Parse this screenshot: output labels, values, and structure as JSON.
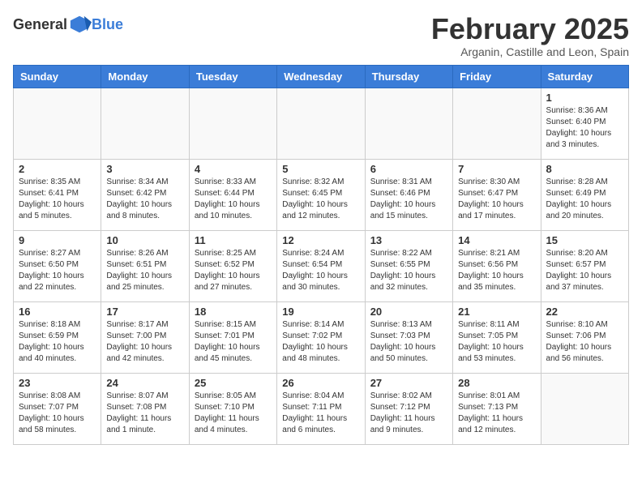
{
  "header": {
    "logo_general": "General",
    "logo_blue": "Blue",
    "title": "February 2025",
    "subtitle": "Arganin, Castille and Leon, Spain"
  },
  "weekdays": [
    "Sunday",
    "Monday",
    "Tuesday",
    "Wednesday",
    "Thursday",
    "Friday",
    "Saturday"
  ],
  "weeks": [
    [
      {
        "day": "",
        "info": ""
      },
      {
        "day": "",
        "info": ""
      },
      {
        "day": "",
        "info": ""
      },
      {
        "day": "",
        "info": ""
      },
      {
        "day": "",
        "info": ""
      },
      {
        "day": "",
        "info": ""
      },
      {
        "day": "1",
        "info": "Sunrise: 8:36 AM\nSunset: 6:40 PM\nDaylight: 10 hours\nand 3 minutes."
      }
    ],
    [
      {
        "day": "2",
        "info": "Sunrise: 8:35 AM\nSunset: 6:41 PM\nDaylight: 10 hours\nand 5 minutes."
      },
      {
        "day": "3",
        "info": "Sunrise: 8:34 AM\nSunset: 6:42 PM\nDaylight: 10 hours\nand 8 minutes."
      },
      {
        "day": "4",
        "info": "Sunrise: 8:33 AM\nSunset: 6:44 PM\nDaylight: 10 hours\nand 10 minutes."
      },
      {
        "day": "5",
        "info": "Sunrise: 8:32 AM\nSunset: 6:45 PM\nDaylight: 10 hours\nand 12 minutes."
      },
      {
        "day": "6",
        "info": "Sunrise: 8:31 AM\nSunset: 6:46 PM\nDaylight: 10 hours\nand 15 minutes."
      },
      {
        "day": "7",
        "info": "Sunrise: 8:30 AM\nSunset: 6:47 PM\nDaylight: 10 hours\nand 17 minutes."
      },
      {
        "day": "8",
        "info": "Sunrise: 8:28 AM\nSunset: 6:49 PM\nDaylight: 10 hours\nand 20 minutes."
      }
    ],
    [
      {
        "day": "9",
        "info": "Sunrise: 8:27 AM\nSunset: 6:50 PM\nDaylight: 10 hours\nand 22 minutes."
      },
      {
        "day": "10",
        "info": "Sunrise: 8:26 AM\nSunset: 6:51 PM\nDaylight: 10 hours\nand 25 minutes."
      },
      {
        "day": "11",
        "info": "Sunrise: 8:25 AM\nSunset: 6:52 PM\nDaylight: 10 hours\nand 27 minutes."
      },
      {
        "day": "12",
        "info": "Sunrise: 8:24 AM\nSunset: 6:54 PM\nDaylight: 10 hours\nand 30 minutes."
      },
      {
        "day": "13",
        "info": "Sunrise: 8:22 AM\nSunset: 6:55 PM\nDaylight: 10 hours\nand 32 minutes."
      },
      {
        "day": "14",
        "info": "Sunrise: 8:21 AM\nSunset: 6:56 PM\nDaylight: 10 hours\nand 35 minutes."
      },
      {
        "day": "15",
        "info": "Sunrise: 8:20 AM\nSunset: 6:57 PM\nDaylight: 10 hours\nand 37 minutes."
      }
    ],
    [
      {
        "day": "16",
        "info": "Sunrise: 8:18 AM\nSunset: 6:59 PM\nDaylight: 10 hours\nand 40 minutes."
      },
      {
        "day": "17",
        "info": "Sunrise: 8:17 AM\nSunset: 7:00 PM\nDaylight: 10 hours\nand 42 minutes."
      },
      {
        "day": "18",
        "info": "Sunrise: 8:15 AM\nSunset: 7:01 PM\nDaylight: 10 hours\nand 45 minutes."
      },
      {
        "day": "19",
        "info": "Sunrise: 8:14 AM\nSunset: 7:02 PM\nDaylight: 10 hours\nand 48 minutes."
      },
      {
        "day": "20",
        "info": "Sunrise: 8:13 AM\nSunset: 7:03 PM\nDaylight: 10 hours\nand 50 minutes."
      },
      {
        "day": "21",
        "info": "Sunrise: 8:11 AM\nSunset: 7:05 PM\nDaylight: 10 hours\nand 53 minutes."
      },
      {
        "day": "22",
        "info": "Sunrise: 8:10 AM\nSunset: 7:06 PM\nDaylight: 10 hours\nand 56 minutes."
      }
    ],
    [
      {
        "day": "23",
        "info": "Sunrise: 8:08 AM\nSunset: 7:07 PM\nDaylight: 10 hours\nand 58 minutes."
      },
      {
        "day": "24",
        "info": "Sunrise: 8:07 AM\nSunset: 7:08 PM\nDaylight: 11 hours\nand 1 minute."
      },
      {
        "day": "25",
        "info": "Sunrise: 8:05 AM\nSunset: 7:10 PM\nDaylight: 11 hours\nand 4 minutes."
      },
      {
        "day": "26",
        "info": "Sunrise: 8:04 AM\nSunset: 7:11 PM\nDaylight: 11 hours\nand 6 minutes."
      },
      {
        "day": "27",
        "info": "Sunrise: 8:02 AM\nSunset: 7:12 PM\nDaylight: 11 hours\nand 9 minutes."
      },
      {
        "day": "28",
        "info": "Sunrise: 8:01 AM\nSunset: 7:13 PM\nDaylight: 11 hours\nand 12 minutes."
      },
      {
        "day": "",
        "info": ""
      }
    ]
  ]
}
